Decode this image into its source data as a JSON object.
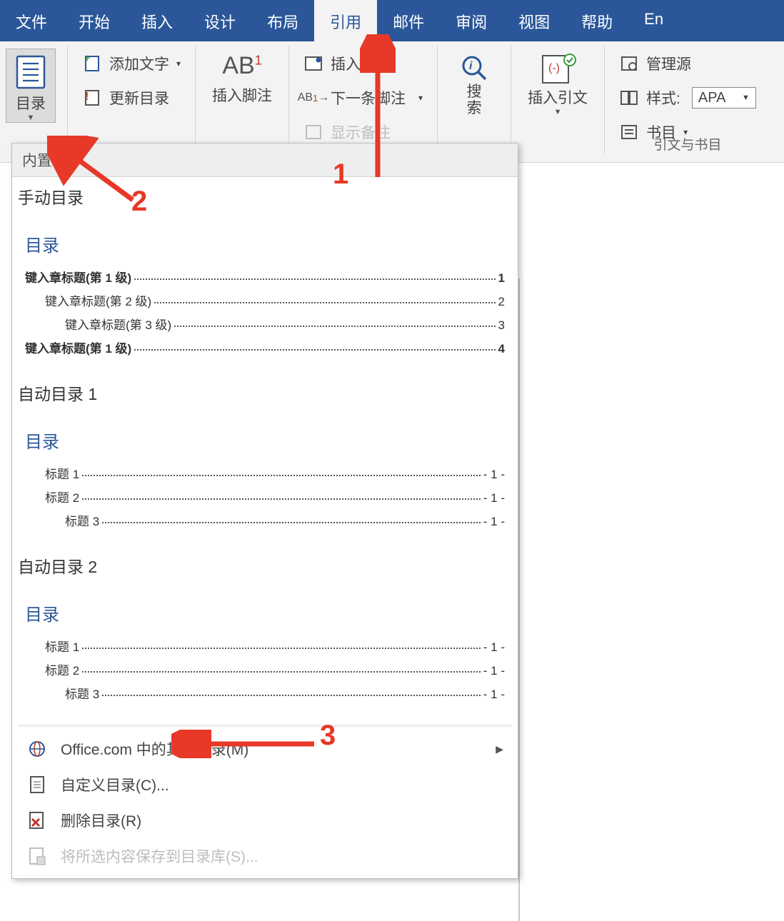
{
  "menubar": {
    "tabs": [
      "文件",
      "开始",
      "插入",
      "设计",
      "布局",
      "引用",
      "邮件",
      "审阅",
      "视图",
      "帮助",
      "En"
    ],
    "activeIndex": 5
  },
  "ribbon": {
    "toc": {
      "label": "目录"
    },
    "addText": "添加文字",
    "updateToc": "更新目录",
    "insertFootnote": "插入脚注",
    "insertFootnoteAB": "AB",
    "insertEndnote": "插入尾注",
    "nextFootnote": "下一条脚注",
    "showNotes": "显示备注",
    "search": "搜\n索",
    "insertCitation": "插入引文",
    "manageSources": "管理源",
    "styleLabel": "样式:",
    "styleValue": "APA",
    "biblioList": "书目",
    "citationsGroup": "引文与书目"
  },
  "dropdown": {
    "builtin": "内置",
    "manualTitle": "手动目录",
    "tocHeading": "目录",
    "manualLines": [
      {
        "text": "键入章标题(第 1 级)",
        "page": "1",
        "indent": 0,
        "bold": true
      },
      {
        "text": "键入章标题(第 2 级)",
        "page": "2",
        "indent": 1,
        "bold": false
      },
      {
        "text": "键入章标题(第 3 级)",
        "page": "3",
        "indent": 2,
        "bold": false
      },
      {
        "text": "键入章标题(第 1 级)",
        "page": "4",
        "indent": 0,
        "bold": true
      }
    ],
    "auto1Title": "自动目录 1",
    "auto2Title": "自动目录 2",
    "autoLines": [
      {
        "text": "标题 1",
        "page": "- 1 -",
        "indent": 0
      },
      {
        "text": "标题 2",
        "page": "- 1 -",
        "indent": 1
      },
      {
        "text": "标题 3",
        "page": "- 1 -",
        "indent": 2
      }
    ],
    "cmdMore": "Office.com 中的其他目录(M)",
    "cmdCustom": "自定义目录(C)...",
    "cmdRemove": "删除目录(R)",
    "cmdSave": "将所选内容保存到目录库(S)..."
  },
  "annotations": {
    "l1": "1",
    "l2": "2",
    "l3": "3"
  }
}
